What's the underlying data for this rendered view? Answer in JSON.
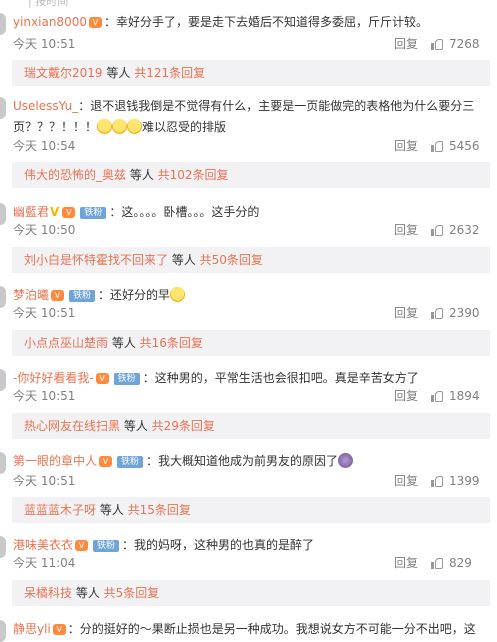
{
  "top_text": "| 按时间",
  "reply_label": "回复",
  "comments": [
    {
      "user": "yinxian8000",
      "text": "：幸好分手了，要是走下去婚后不知道得多委屈，斤斤计较。",
      "time": "今天 10:51",
      "likes": "7268",
      "sub": {
        "name": "瑞文戴尔2019",
        "mid": " 等人 ",
        "tail": "共121条回复"
      }
    },
    {
      "user": "UselessYu_",
      "text": "：退不退钱我倒是不觉得有什么，主要是一页能做完的表格他为什么要分三页？？？！！！",
      "text_end": "难以忍受的排版",
      "time": "今天 10:54",
      "likes": "5456",
      "sub": {
        "name": "伟大的恐怖的_奥兹",
        "mid": " 等人 ",
        "tail": "共102条回复"
      }
    },
    {
      "user": "幽藍君",
      "fan_label": "铁粉",
      "text": "：这。。。。卧槽。。。这手分的",
      "time": "今天 10:50",
      "likes": "2632",
      "sub": {
        "name": "刘小白是怀特霍找不回来了",
        "mid": " 等人 ",
        "tail": "共50条回复"
      }
    },
    {
      "user": "梦泊曦",
      "fan_label": "铁粉",
      "text": "：还好分的早",
      "time": "今天 10:51",
      "likes": "2390",
      "sub": {
        "name": "小点点巫山楚雨",
        "mid": " 等人 ",
        "tail": "共16条回复"
      }
    },
    {
      "user": "-你好好看看我-",
      "fan_label": "铁粉",
      "text": "：这种男的，平常生活也会很扣吧。真是辛苦女方了",
      "time": "今天 10:51",
      "likes": "1894",
      "sub": {
        "name": "热心网友在线扫黑",
        "mid": " 等人 ",
        "tail": "共29条回复"
      }
    },
    {
      "user": "第一眼的章中人",
      "fan_label": "铁粉",
      "text": "：我大概知道他成为前男友的原因了",
      "time": "今天 10:51",
      "likes": "1399",
      "sub": {
        "name": "蓝蓝蓝木子呀",
        "mid": " 等人 ",
        "tail": "共15条回复"
      }
    },
    {
      "user": "港味美衣衣",
      "fan_label": "铁粉",
      "text": "：我的妈呀，这种男的也真的是醉了",
      "time": "今天 11:04",
      "likes": "829",
      "sub": {
        "name": "呆橘科技",
        "mid": " 等人 ",
        "tail": "共5条回复"
      }
    },
    {
      "user": "静思yli",
      "text": "：分的挺好的～果断止损也是另一种成功。我想说女方不可能一分不出吧，这"
    }
  ]
}
